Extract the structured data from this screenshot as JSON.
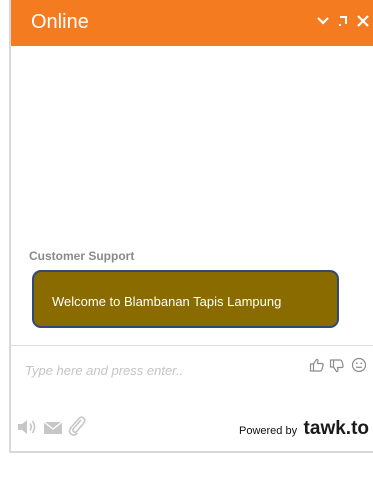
{
  "header": {
    "title": "Online",
    "background": "#f47b20",
    "buttons": [
      {
        "name": "minimize-button",
        "glyph": "chevron-down-icon"
      },
      {
        "name": "popout-button",
        "glyph": "popout-icon"
      },
      {
        "name": "close-button",
        "glyph": "close-icon"
      }
    ]
  },
  "conversation": {
    "agent_name": "Customer Support",
    "message": "Welcome to Blambanan Tapis Lampung",
    "bubble_color": "#896b00",
    "bubble_border": "#2e4a75"
  },
  "composer": {
    "placeholder": "Type here and press enter..",
    "rating_icons": [
      "thumbs-up-icon",
      "thumbs-down-icon",
      "emoji-icon"
    ]
  },
  "footer": {
    "tools": [
      "sound-icon",
      "email-icon",
      "attachment-icon"
    ],
    "powered_by_label": "Powered by",
    "powered_by_brand": "tawk.to"
  }
}
